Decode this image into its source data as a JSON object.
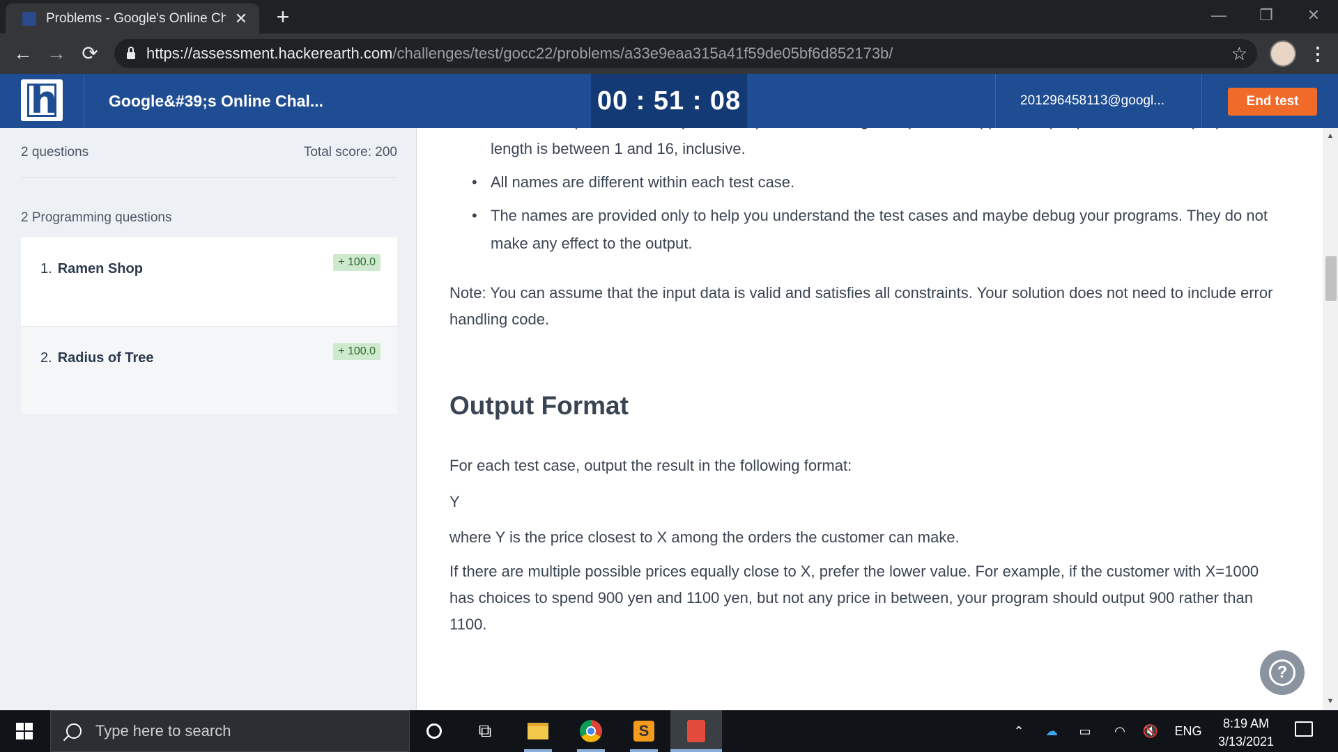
{
  "browser": {
    "tab_title": "Problems - Google's Online Chall",
    "tab_close": "✕",
    "new_tab": "+",
    "url_host": "https://assessment.hackerearth.com",
    "url_path": "/challenges/test/gocc22/problems/a33e9eaa315a41f59de05bf6d852173b/",
    "window_controls": [
      "—",
      "❐",
      "✕"
    ],
    "back": "←",
    "forward": "→",
    "reload": "⟳",
    "star": "☆",
    "menu": "⋮"
  },
  "header": {
    "logo_letter": "h",
    "test_name": "Google&#39;s Online Chal...",
    "timer": "00 : 51 : 08",
    "user_email": "201296458113@googl...",
    "end_test": "End test"
  },
  "sidebar": {
    "question_count": "2 questions",
    "total_score": "Total score: 200",
    "group_title": "2 Programming questions",
    "questions": [
      {
        "num": "1.",
        "name": "Ramen Shop",
        "score": "+ 100.0"
      },
      {
        "num": "2.",
        "name": "Radius of Tree",
        "score": "+ 100.0"
      }
    ]
  },
  "content": {
    "bullet_cut": "Each name (FlavorName, OptionName) consists of English alphabets, uppercase (A-Z) and lowercase (a-z), and its length is between 1 and 16, inclusive.",
    "bullet_2": "All names are different within each test case.",
    "bullet_3": "The names are provided only to help you understand the test cases and maybe debug your programs. They do not make any effect to the output.",
    "note": "Note: You can assume that the input data is valid and satisfies all constraints. Your solution does not need to include error handling code.",
    "output_heading": "Output Format",
    "output_intro": "For each test case, output the result in the following format:",
    "output_sample": "Y",
    "output_explain": "where Y is the price closest to X among the orders the customer can make.",
    "tie_rule": "If there are multiple possible prices equally close to X, prefer the lower value. For example, if the customer with X=1000 has choices to spend 900 yen and 1100 yen, but not any price in between, your program should output 900 rather than 1100.",
    "help": "?"
  },
  "taskbar": {
    "search_placeholder": "Type here to search",
    "lang": "ENG",
    "time": "8:19 AM",
    "date": "3/13/2021",
    "sublime_letter": "S"
  }
}
